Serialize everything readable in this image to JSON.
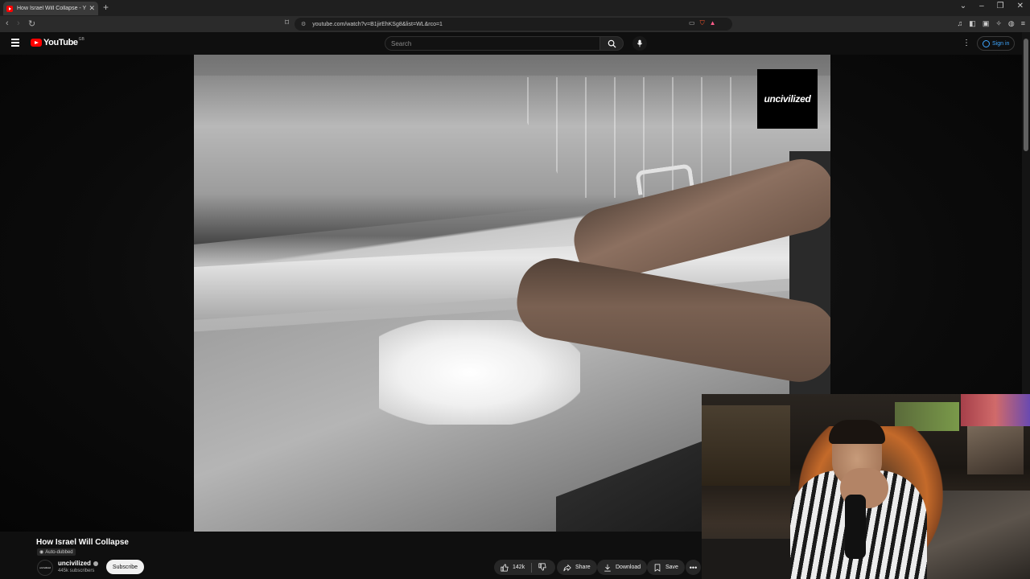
{
  "browser": {
    "tab_title": "How Israel Will Collapse - YouTube",
    "tab_close": "✕",
    "new_tab": "+",
    "url": "youtube.com/watch?v=B1jirEhKSg8&list=WL&rco=1",
    "window_controls": [
      "⌄",
      "–",
      "❐",
      "✕"
    ]
  },
  "youtube": {
    "logo_text": "YouTube",
    "logo_superscript": "GB",
    "search_placeholder": "Search",
    "signin_label": "Sign in"
  },
  "video": {
    "watermark": "uncivilized",
    "title": "How Israel Will Collapse",
    "badge": "Auto-dubbed"
  },
  "channel": {
    "avatar_text": "uncivilized",
    "name": "uncivilized",
    "subscribers": "445k subscribers",
    "subscribe_label": "Subscribe"
  },
  "actions": {
    "likes": "142k",
    "share": "Share",
    "download": "Download",
    "save": "Save",
    "more": "•••"
  }
}
